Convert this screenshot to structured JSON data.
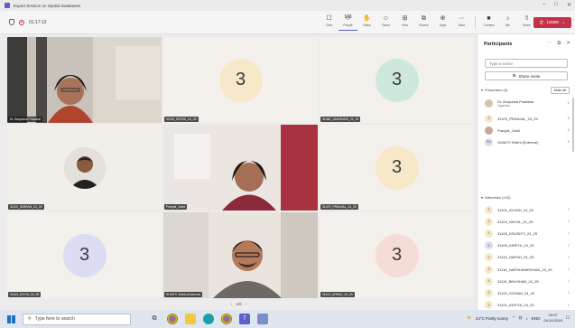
{
  "window": {
    "title": "Expert Session on Spatial Databases"
  },
  "toolbar": {
    "timer": "01:17:13",
    "people_count": "106",
    "items": [
      {
        "label": "Chat",
        "glyph": "☐"
      },
      {
        "label": "People",
        "glyph": "☺"
      },
      {
        "label": "Raise",
        "glyph": "✋"
      },
      {
        "label": "React",
        "glyph": "☺"
      },
      {
        "label": "View",
        "glyph": "⊞"
      },
      {
        "label": "Rooms",
        "glyph": "⧉"
      },
      {
        "label": "Apps",
        "glyph": "⊕"
      },
      {
        "label": "More",
        "glyph": "···"
      }
    ],
    "media": [
      {
        "label": "Camera",
        "glyph": "■"
      },
      {
        "label": "Mic",
        "glyph": "♪"
      },
      {
        "label": "Share",
        "glyph": "⇧"
      }
    ],
    "leave_label": "Leave"
  },
  "tiles": [
    {
      "name": "Dr. Anupama Prakahar",
      "type": "video"
    },
    {
      "name": "31140_NITISH_24_25",
      "type": "avatar",
      "initial": "3",
      "color": "#f6e8c8"
    },
    {
      "name": "31080_VAISHNAVI_24_25",
      "type": "avatar",
      "initial": "3",
      "color": "#cfe8dc"
    },
    {
      "name": "31102_SIMRAN_24_25",
      "type": "photo"
    },
    {
      "name": "Pranjali_Joshi",
      "type": "video"
    },
    {
      "name": "31470_PRANJAL_24_25",
      "type": "avatar",
      "initial": "3",
      "color": "#f6e8c8"
    },
    {
      "name": "31104_DIVYA_24_25",
      "type": "avatar",
      "initial": "3",
      "color": "#dcdcf2"
    },
    {
      "name": "SHAKTI Shikhi (External)",
      "type": "video"
    },
    {
      "name": "31102_ARNAV_24_25",
      "type": "avatar",
      "initial": "3",
      "color": "#f6dcd6"
    }
  ],
  "pager": {
    "prev": "‹",
    "text": "1/6",
    "next": "›"
  },
  "panel": {
    "title": "Participants",
    "search_placeholder": "Type a name",
    "share_label": "Share invite",
    "presenters_label": "Presenters (4)",
    "mute_all": "Mute all",
    "attendees_label": "Attendees (102)",
    "presenters": [
      {
        "name": "Dr. Anupama Prakahar",
        "role": "Organizer",
        "av_color": "#d6c3a8",
        "av": ""
      },
      {
        "name": "31470_PRANJAL_24_25",
        "role": "",
        "av_color": "#f6e8c8",
        "av": "3"
      },
      {
        "name": "Pranjali_Joshi",
        "role": "",
        "av_color": "#c9a59a",
        "av": ""
      },
      {
        "name": "SHAKTI Shikhi (External)",
        "role": "",
        "av_color": "#dcdcf2",
        "av": "SS"
      }
    ],
    "attendees": [
      {
        "name": "31101_AYUSH_24_25",
        "av_color": "#f6e8c8"
      },
      {
        "name": "31104_NIKHIL_24_25",
        "av_color": "#f6e8c8"
      },
      {
        "name": "31106_DRUSHTI_24_25",
        "av_color": "#f6e8c8"
      },
      {
        "name": "31105_ARPITA_24_25",
        "av_color": "#dcdcf2"
      },
      {
        "name": "31113_HARSH_24_25",
        "av_color": "#f6e8c8"
      },
      {
        "name": "31116_HARSHWARDHAN_24_25",
        "av_color": "#f6e8c8"
      },
      {
        "name": "31119_BHUSHAN_24_25",
        "av_color": "#f6e8c8"
      },
      {
        "name": "31120_SOHAM_24_25",
        "av_color": "#f6e8c8"
      },
      {
        "name": "31121_ADITYA_24_25",
        "av_color": "#f6e8c8"
      }
    ]
  },
  "taskbar": {
    "search_placeholder": "Type here to search",
    "weather": "24°C  Partly sunny",
    "lang": "ENG",
    "time": "10:07",
    "date": "04-10-2024"
  }
}
